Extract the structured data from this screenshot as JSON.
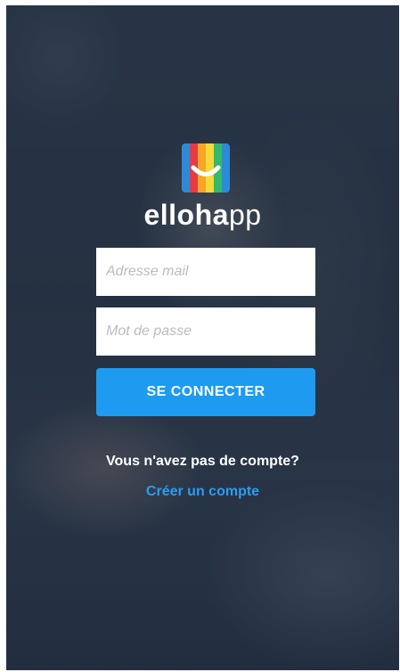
{
  "brand": {
    "name_bold": "elloha",
    "name_light": "pp",
    "logo_colors": [
      "#2e8ad8",
      "#e63a44",
      "#f5a623",
      "#f6d93b",
      "#35b96b",
      "#2e8ad8"
    ]
  },
  "login": {
    "email_placeholder": "Adresse mail",
    "password_placeholder": "Mot de passe",
    "submit_label": "SE CONNECTER"
  },
  "signup": {
    "prompt": "Vous n'avez pas de compte?",
    "link_label": "Créer un compte"
  },
  "colors": {
    "accent": "#1e9bf0",
    "link": "#2a9cf3"
  }
}
